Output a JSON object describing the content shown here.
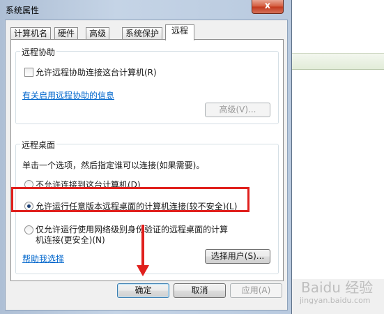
{
  "window": {
    "title": "系统属性",
    "close_glyph": "x"
  },
  "tabs": [
    {
      "label": "计算机名"
    },
    {
      "label": "硬件"
    },
    {
      "label": "高级"
    },
    {
      "label": "系统保护"
    },
    {
      "label": "远程",
      "active": true
    }
  ],
  "remote_assistance": {
    "group_label": "远程协助",
    "allow_checkbox_label": "允许远程协助连接这台计算机(R)",
    "allow_checked": false,
    "info_link": "有关启用远程协助的信息",
    "advanced_button": "高级(V)..."
  },
  "remote_desktop": {
    "group_label": "远程桌面",
    "instruction": "单击一个选项，然后指定谁可以连接(如果需要)。",
    "options": [
      {
        "label": "不允许连接到这台计算机(D)",
        "checked": false
      },
      {
        "label": "允许运行任意版本远程桌面的计算机连接(较不安全)(L)",
        "checked": true
      },
      {
        "label_line1": "仅允许运行使用网络级别身份验证的远程桌面的计算",
        "label_line2": "机连接(更安全)(N)",
        "checked": false
      }
    ],
    "help_link": "帮助我选择",
    "select_users_button": "选择用户(S)..."
  },
  "footer": {
    "ok": "确定",
    "cancel": "取消",
    "apply": "应用(A)"
  },
  "watermark": {
    "brand": "Baidu 经验",
    "sub": "jingyan.baidu.com"
  },
  "colors": {
    "annotation": "#e0201d",
    "link": "#0066cc"
  }
}
